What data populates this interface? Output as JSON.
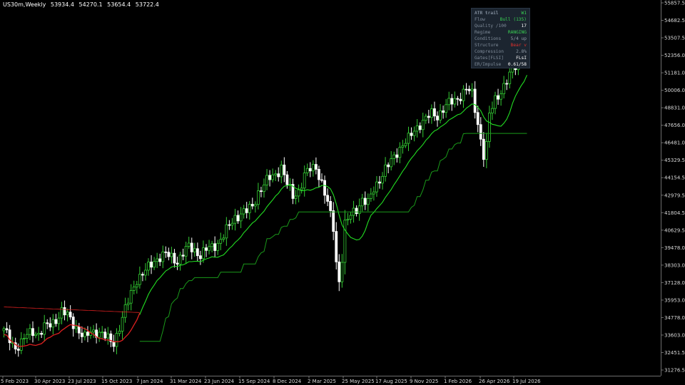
{
  "chart_header": {
    "symbol": "US30m,Weekly",
    "open": "53934.4",
    "high": "54270.1",
    "low": "53654.4",
    "close": "53722.4"
  },
  "info_panel": {
    "title": "ATR trail",
    "timeframe": "W1",
    "rows": [
      {
        "key": "Flow",
        "value": "Bull (135)",
        "color": "#39d353"
      },
      {
        "key": "Quality /100",
        "value": "17",
        "color": "#ffffff"
      },
      {
        "key": "Regime",
        "value": "RANGING",
        "color": "#39d353"
      },
      {
        "key": "Conditions",
        "value": "5/4 up",
        "color": "#8f9aa6"
      },
      {
        "key": "Structure",
        "value": "Bear v",
        "color": "#e0302c"
      },
      {
        "key": "Compression",
        "value": "2.8%",
        "color": "#8f9aa6"
      },
      {
        "key": "Gates[FLSI]",
        "value": "FLsI",
        "color": "#ffffff"
      },
      {
        "key": "ER/Impulse",
        "value": "0.61/58",
        "color": "#ffffff"
      }
    ]
  },
  "colors": {
    "background": "#000000",
    "candle_up": "#33cc33",
    "candle_down": "#ffffff",
    "trail_fast": "#22dd22",
    "trail_slow": "#1a9a1a",
    "trail_bear": "#dd2020",
    "axis": "#6e6e6e",
    "axis_text": "#d8d8d8"
  },
  "chart_data": {
    "type": "candlestick",
    "y_axis_ticks": [
      "55857.5",
      "54682.5",
      "53507.5",
      "52356.0",
      "51181.0",
      "50006.0",
      "48831.0",
      "47656.0",
      "46481.0",
      "45329.5",
      "44154.5",
      "42979.5",
      "41804.5",
      "40629.5",
      "39478.0",
      "38303.0",
      "37128.0",
      "35953.0",
      "34778.0",
      "33603.0",
      "32451.5",
      "31276.5"
    ],
    "ylim": [
      31276.5,
      55857.5
    ],
    "x_axis_ticks": [
      "5 Feb 2023",
      "30 Apr 2023",
      "23 Jul 2023",
      "15 Oct 2023",
      "7 Jan 2024",
      "31 Mar 2024",
      "23 Jun 2024",
      "15 Sep 2024",
      "8 Dec 2024",
      "2 Mar 2025",
      "25 May 2025",
      "17 Aug 2025",
      "9 Nov 2025",
      "1 Feb 2026",
      "26 Apr 2026",
      "19 Jul 2026"
    ],
    "close_anchors": [
      [
        0,
        33900
      ],
      [
        2,
        33300
      ],
      [
        4,
        32800
      ],
      [
        6,
        33100
      ],
      [
        8,
        33600
      ],
      [
        10,
        33900
      ],
      [
        12,
        33700
      ],
      [
        14,
        34100
      ],
      [
        16,
        34300
      ],
      [
        18,
        34700
      ],
      [
        20,
        35200
      ],
      [
        22,
        34900
      ],
      [
        24,
        34400
      ],
      [
        26,
        33900
      ],
      [
        28,
        33400
      ],
      [
        30,
        33800
      ],
      [
        32,
        33900
      ],
      [
        34,
        33700
      ],
      [
        36,
        33300
      ],
      [
        38,
        33100
      ],
      [
        40,
        34200
      ],
      [
        42,
        35300
      ],
      [
        44,
        36400
      ],
      [
        46,
        37400
      ],
      [
        48,
        37700
      ],
      [
        50,
        38100
      ],
      [
        52,
        38600
      ],
      [
        54,
        38900
      ],
      [
        56,
        39000
      ],
      [
        58,
        38800
      ],
      [
        60,
        38600
      ],
      [
        62,
        39100
      ],
      [
        64,
        39500
      ],
      [
        66,
        39300
      ],
      [
        68,
        39000
      ],
      [
        70,
        39300
      ],
      [
        72,
        39500
      ],
      [
        74,
        39800
      ],
      [
        76,
        40300
      ],
      [
        78,
        40900
      ],
      [
        80,
        41500
      ],
      [
        82,
        41800
      ],
      [
        84,
        41900
      ],
      [
        86,
        42200
      ],
      [
        88,
        43200
      ],
      [
        90,
        43700
      ],
      [
        92,
        44100
      ],
      [
        94,
        44400
      ],
      [
        96,
        44900
      ],
      [
        98,
        43700
      ],
      [
        100,
        42900
      ],
      [
        102,
        43300
      ],
      [
        104,
        44300
      ],
      [
        106,
        44700
      ],
      [
        108,
        44900
      ],
      [
        110,
        43800
      ],
      [
        112,
        42400
      ],
      [
        114,
        40800
      ],
      [
        115,
        38500
      ],
      [
        116,
        37300
      ],
      [
        117,
        38800
      ],
      [
        118,
        41000
      ],
      [
        120,
        41600
      ],
      [
        122,
        42100
      ],
      [
        124,
        42700
      ],
      [
        126,
        42400
      ],
      [
        128,
        43400
      ],
      [
        130,
        44100
      ],
      [
        132,
        44700
      ],
      [
        134,
        45200
      ],
      [
        136,
        45900
      ],
      [
        138,
        46400
      ],
      [
        140,
        46700
      ],
      [
        142,
        47300
      ],
      [
        144,
        47800
      ],
      [
        146,
        48100
      ],
      [
        148,
        48400
      ],
      [
        150,
        48300
      ],
      [
        152,
        48800
      ],
      [
        154,
        49100
      ],
      [
        156,
        49300
      ],
      [
        158,
        49700
      ],
      [
        160,
        50100
      ],
      [
        162,
        49700
      ],
      [
        164,
        47800
      ],
      [
        166,
        45700
      ],
      [
        167,
        46300
      ],
      [
        168,
        48300
      ],
      [
        170,
        49400
      ],
      [
        172,
        50000
      ],
      [
        174,
        50600
      ],
      [
        176,
        51300
      ],
      [
        178,
        52000
      ],
      [
        180,
        52700
      ],
      [
        181,
        53722
      ]
    ],
    "series": [
      {
        "name": "",
        "style": "trail_fast"
      },
      {
        "name": "",
        "style": "trail_slow"
      },
      {
        "name": "",
        "style": "trail_bear"
      }
    ]
  }
}
